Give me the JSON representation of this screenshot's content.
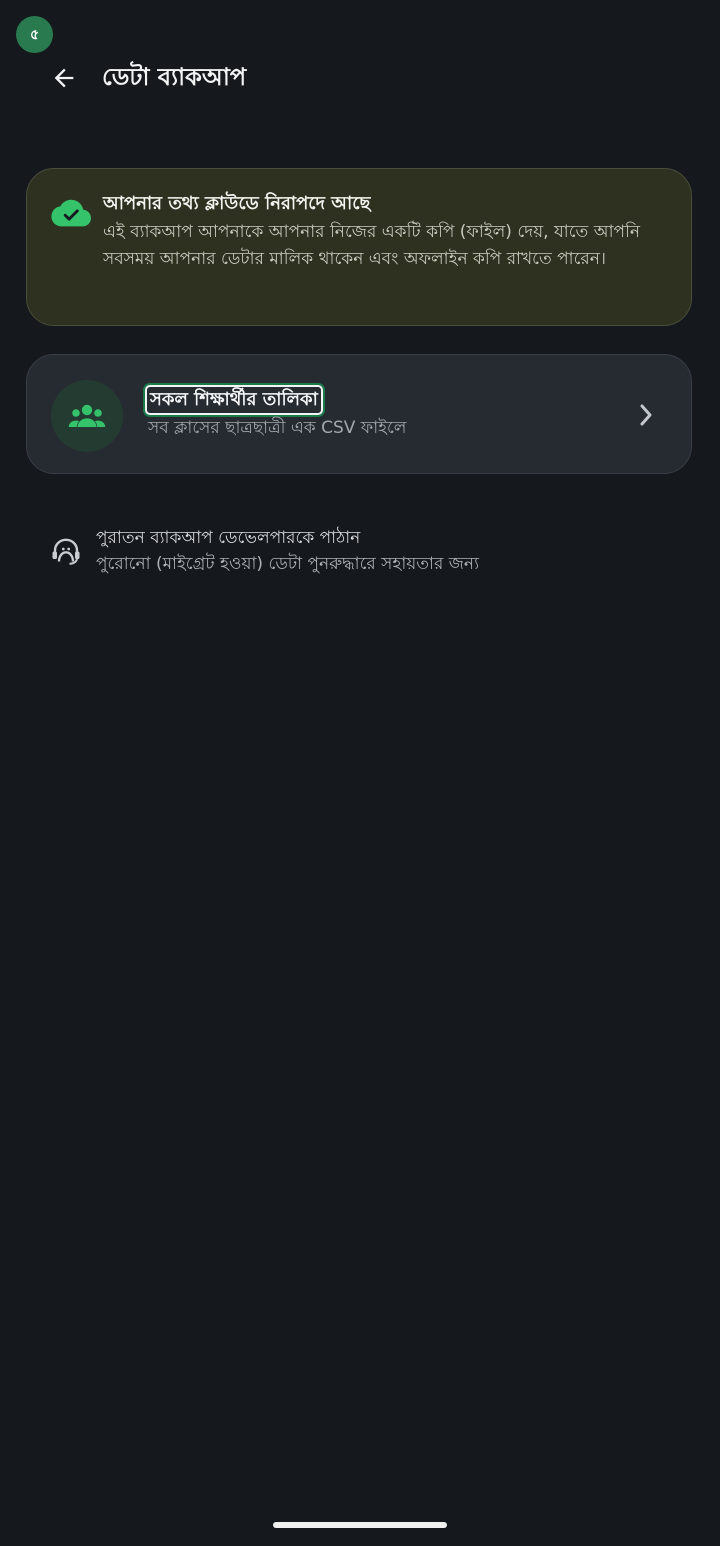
{
  "status_bar": {
    "app_badge": "৫"
  },
  "appbar": {
    "back_icon": "arrow-left-icon",
    "title": "ডেটা ব্যাকআপ"
  },
  "info_card": {
    "icon": "cloud-check-icon",
    "title": "আপনার তথ্য ক্লাউডে নিরাপদে আছে",
    "description": "এই ব্যাকআপ আপনাকে আপনার নিজের একটি কপি (ফাইল) দেয়, যাতে আপনি সবসময় আপনার ডেটার মালিক থাকেন এবং অফলাইন কপি রাখতে পারেন।",
    "colors": {
      "background": "#2e3120",
      "accent": "#34c26b"
    }
  },
  "export_option": {
    "icon": "group-icon",
    "title": "সকল শিক্ষার্থীর তালিকা",
    "subtitle": "সব ক্লাসের ছাত্রছাত্রী এক CSV ফাইলে",
    "trailing_icon": "chevron-right-icon"
  },
  "legacy_option": {
    "icon": "support-agent-icon",
    "title": "পুরাতন ব্যাকআপ ডেভেলপারকে পাঠান",
    "subtitle": "পুরোনো (মাইগ্রেট হওয়া) ডেটা পুনরুদ্ধারে সহায়তার জন্য"
  },
  "theme": {
    "background": "#15181c",
    "card": "#262a31",
    "accent_green": "#34c26b"
  }
}
